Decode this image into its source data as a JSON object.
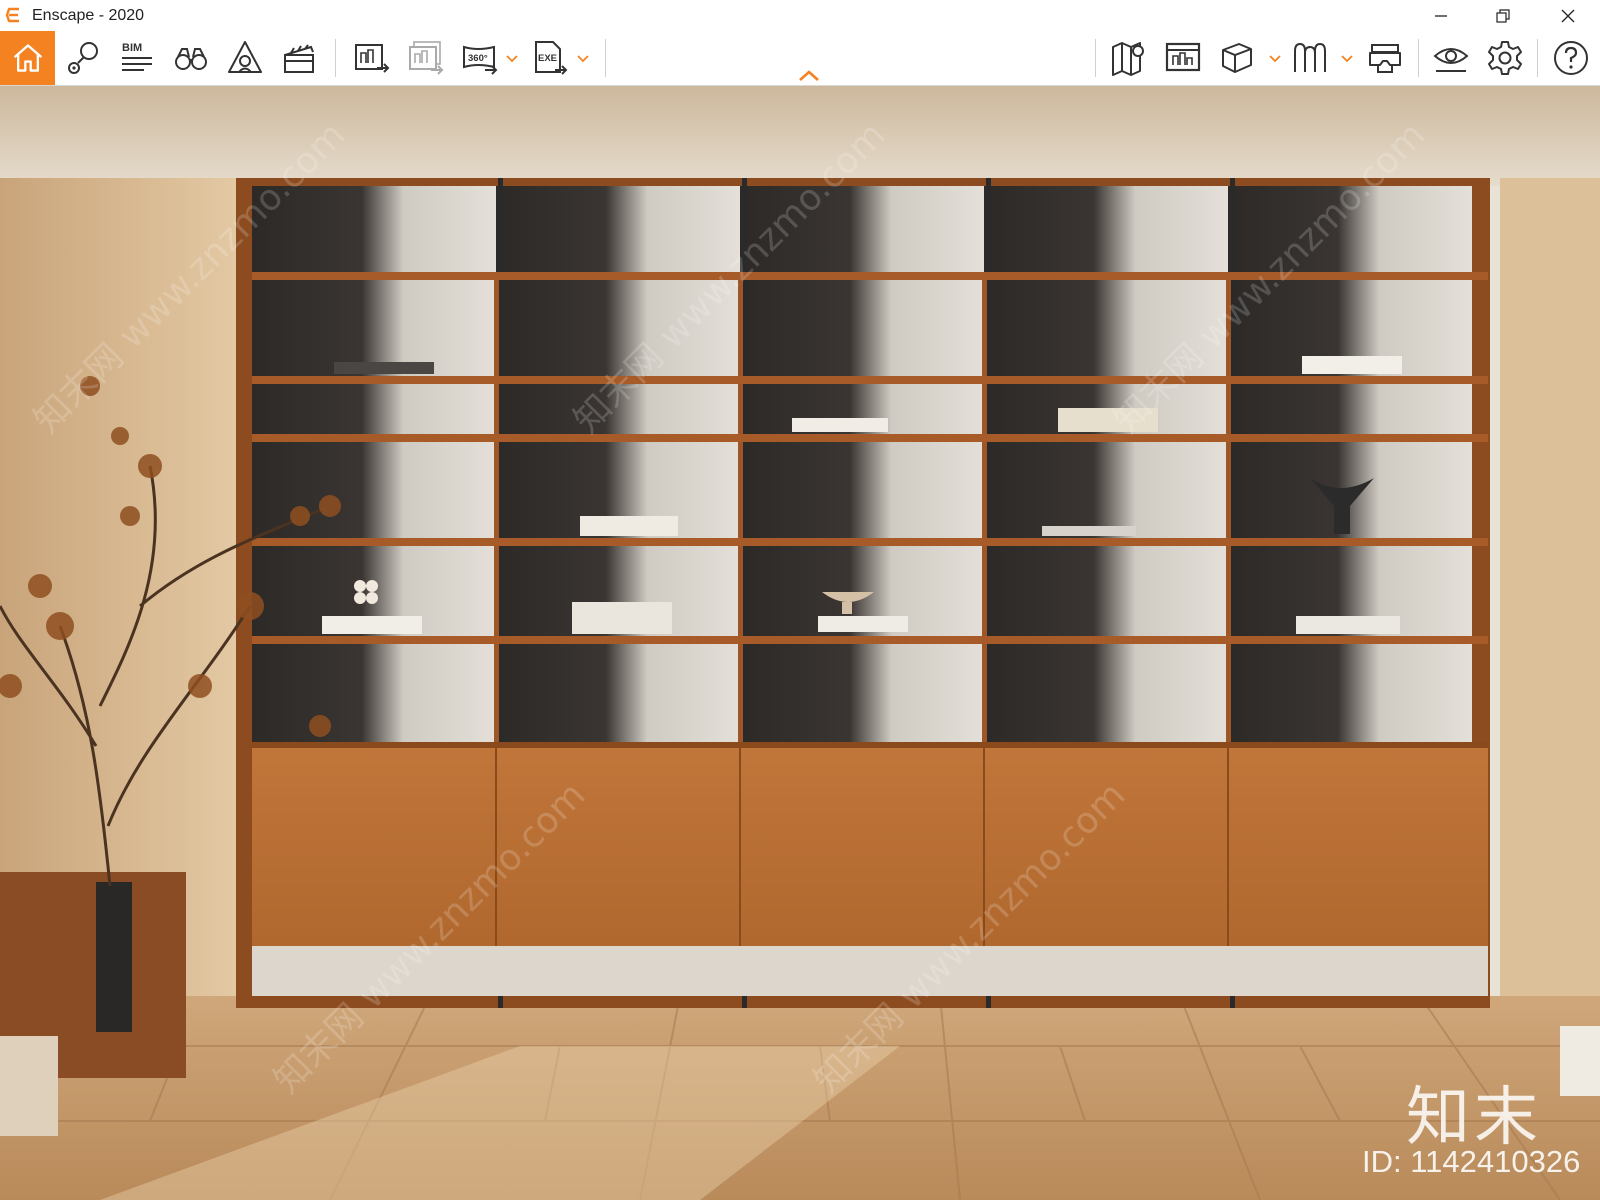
{
  "window": {
    "title": "Enscape - 2020",
    "logo_icon": "enscape-logo-icon",
    "controls": [
      "minimize-icon",
      "restore-icon",
      "close-icon"
    ]
  },
  "toolbar": {
    "accent_color": "#f58220",
    "left_buttons": [
      {
        "name": "home",
        "icon": "home-icon",
        "active": true
      },
      {
        "name": "views",
        "icon": "map-pin-icon"
      },
      {
        "name": "bim",
        "icon": "bim-icon",
        "label": "BIM"
      },
      {
        "name": "binoculars",
        "icon": "binoculars-icon"
      },
      {
        "name": "atmosphere",
        "icon": "atmosphere-icon"
      },
      {
        "name": "video-editor",
        "icon": "clapperboard-icon"
      },
      {
        "name": "screenshot-export",
        "icon": "render-export-icon"
      },
      {
        "name": "batch-export",
        "icon": "batch-export-icon"
      },
      {
        "name": "panorama",
        "icon": "panorama-360-icon",
        "label": "360°",
        "dropdown": true
      },
      {
        "name": "exe-export",
        "icon": "exe-export-icon",
        "label": "EXE",
        "dropdown": true
      }
    ],
    "right_buttons": [
      {
        "name": "map",
        "icon": "map-icon"
      },
      {
        "name": "capture-manager",
        "icon": "capture-icon"
      },
      {
        "name": "asset-library",
        "icon": "cube-icon",
        "dropdown": true
      },
      {
        "name": "material-editor",
        "icon": "material-icon",
        "dropdown": true
      },
      {
        "name": "vr-headset",
        "icon": "vr-headset-icon"
      },
      {
        "name": "visibility",
        "icon": "eye-icon"
      },
      {
        "name": "settings",
        "icon": "gear-icon"
      },
      {
        "name": "help",
        "icon": "help-icon"
      }
    ],
    "collapse_icon": "chevron-up-icon"
  },
  "watermark": {
    "logo_text": "知末",
    "id_text": "ID: 1142410326",
    "site_text": "知末网 www.znzmo.com"
  }
}
